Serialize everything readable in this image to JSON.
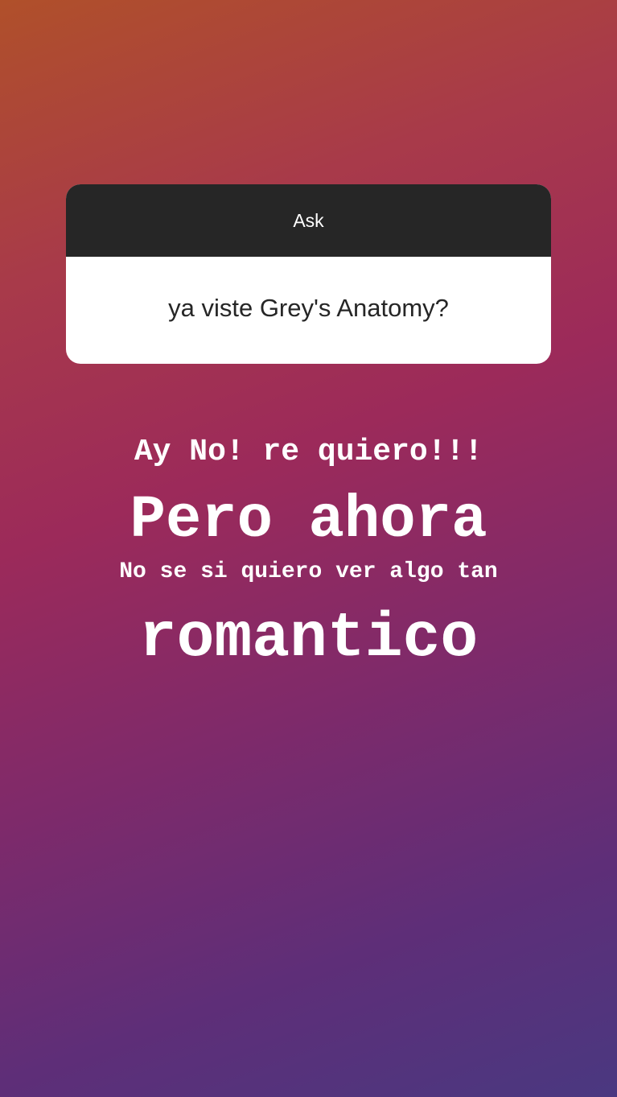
{
  "question_sticker": {
    "title": "Ask",
    "question": "ya viste Grey's Anatomy?"
  },
  "story_text": {
    "line1": "Ay No! re quiero!!!",
    "line2": "Pero ahora",
    "line3": "No se si quiero ver algo tan",
    "line4": "romantico"
  },
  "colors": {
    "sticker_header": "#262626",
    "sticker_body": "#ffffff",
    "text": "#ffffff",
    "gradient_top": "#b0502a",
    "gradient_middle": "#9c2a5a",
    "gradient_bottom": "#4a3880"
  }
}
